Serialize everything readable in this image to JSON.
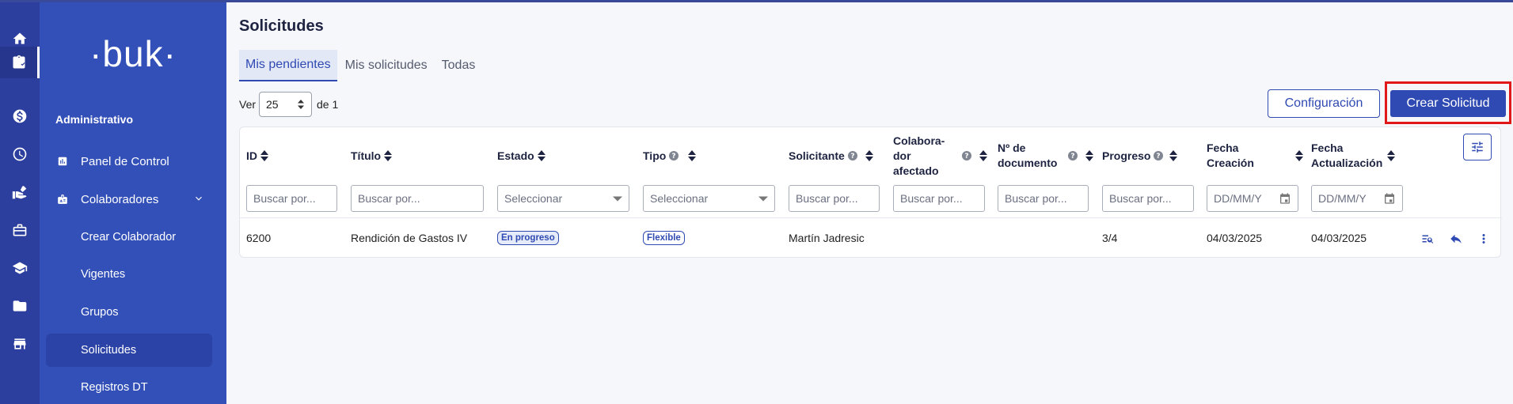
{
  "sidebar": {
    "logo": "buk",
    "section_title": "Administrativo",
    "items": [
      {
        "label": "Panel de Control"
      },
      {
        "label": "Colaboradores"
      },
      {
        "label": "Crear Colaborador"
      },
      {
        "label": "Vigentes"
      },
      {
        "label": "Grupos"
      },
      {
        "label": "Solicitudes"
      },
      {
        "label": "Registros DT"
      }
    ]
  },
  "rail": {
    "icons": [
      "home-icon",
      "clipboard-icon",
      "money-icon",
      "clock-icon",
      "hand-icon",
      "briefcase-icon",
      "graduation-icon",
      "folder-icon",
      "store-icon"
    ]
  },
  "page": {
    "title": "Solicitudes",
    "tabs": [
      {
        "label": "Mis pendientes"
      },
      {
        "label": "Mis solicitudes"
      },
      {
        "label": "Todas"
      }
    ]
  },
  "pager": {
    "ver_label": "Ver",
    "page_size": "25",
    "of_label": "de 1"
  },
  "actions": {
    "config_label": "Configuración",
    "create_label": "Crear Solicitud"
  },
  "table": {
    "headers": {
      "id": "ID",
      "titulo": "Título",
      "estado": "Estado",
      "tipo": "Tipo",
      "solicitante": "Solicitante",
      "colaborador_1": "Colabora-",
      "colaborador_2": "dor",
      "colaborador_3": "afectado",
      "documento_1": "Nº de",
      "documento_2": "documento",
      "progreso": "Progreso",
      "creacion_1": "Fecha",
      "creacion_2": "Creación",
      "actualizacion_1": "Fecha",
      "actualizacion_2": "Actualización"
    },
    "filters": {
      "search_placeholder": "Buscar por...",
      "select_placeholder": "Seleccionar",
      "date_placeholder": "DD/MM/Y"
    },
    "rows": [
      {
        "id": "6200",
        "titulo": "Rendición de Gastos IV",
        "estado": "En progreso",
        "tipo": "Flexible",
        "solicitante": "Martín Jadresic",
        "colaborador": "",
        "documento": "",
        "progreso": "3/4",
        "creacion": "04/03/2025",
        "actualizacion": "04/03/2025"
      }
    ]
  },
  "colors": {
    "rail": "#2c3f9e",
    "sidebar": "#3350b8",
    "primary": "#2f4ab2",
    "highlight": "#e01818"
  }
}
